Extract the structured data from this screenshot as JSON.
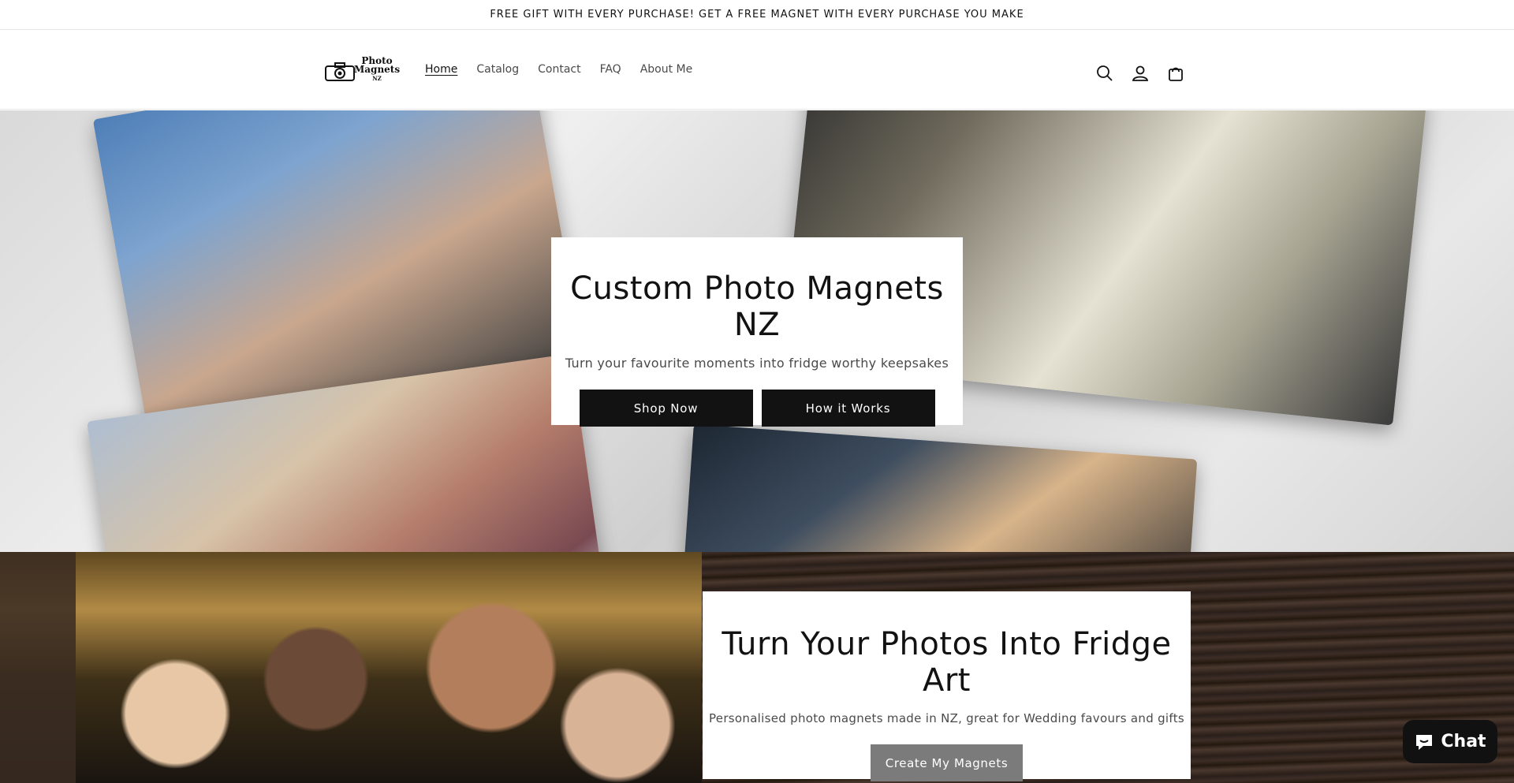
{
  "announcement": "FREE GIFT WITH EVERY PURCHASE! GET A FREE MAGNET WITH EVERY PURCHASE YOU MAKE",
  "logo": {
    "line1": "Photo",
    "line2": "Magnets",
    "line3": "NZ"
  },
  "nav": [
    {
      "label": "Home",
      "active": true
    },
    {
      "label": "Catalog"
    },
    {
      "label": "Contact"
    },
    {
      "label": "FAQ"
    },
    {
      "label": "About Me"
    }
  ],
  "icons": [
    "search-icon",
    "account-icon",
    "cart-icon"
  ],
  "hero": {
    "title": "Custom Photo Magnets NZ",
    "subtitle": "Turn your favourite moments into fridge worthy keepsakes",
    "primary_button": "Shop Now",
    "secondary_button": "How it Works"
  },
  "section2": {
    "title": "Turn Your Photos Into Fridge Art",
    "subtitle": "Personalised photo magnets made in NZ, great for Wedding favours and gifts",
    "button": "Create My Magnets"
  },
  "chat": {
    "label": "Chat"
  },
  "colors": {
    "button_dark": "#121212",
    "button_gray": "#7b7b7b",
    "text": "#121212",
    "muted": "#4a4a4a"
  }
}
